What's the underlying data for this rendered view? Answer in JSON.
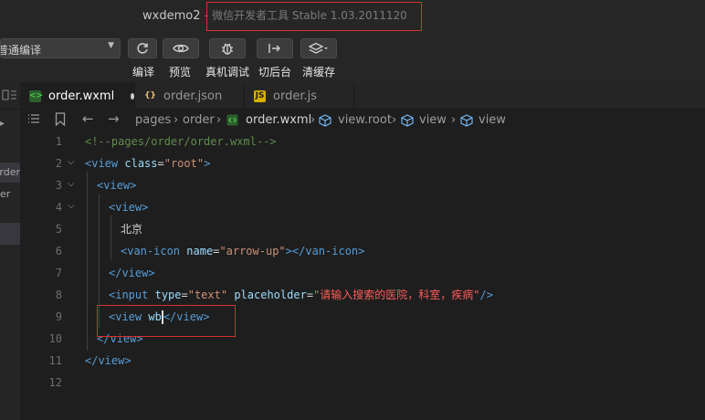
{
  "window": {
    "project": "wxdemo2",
    "separator": "-",
    "app_name": "微信开发者工具 Stable 1.03.2011120"
  },
  "toolbar": {
    "compile_mode": "普通编译",
    "buttons": [
      {
        "icon": "refresh-icon",
        "label": "编译"
      },
      {
        "icon": "eye-icon",
        "label": "预览"
      },
      {
        "icon": "bug-icon",
        "label": "真机调试"
      },
      {
        "icon": "switch-icon",
        "label": "切后台"
      },
      {
        "icon": "layers-icon",
        "label": "清缓存"
      }
    ]
  },
  "tabs": [
    {
      "label": "order.wxml",
      "icon": "<>",
      "color": "#4ec94e",
      "active": true,
      "modified": true
    },
    {
      "label": "order.json",
      "icon": "{}",
      "color": "#e5c07b",
      "active": false
    },
    {
      "label": "order.js",
      "icon": "JS",
      "color": "#f0d000",
      "active": false
    }
  ],
  "breadcrumb": {
    "items": [
      "pages",
      "order",
      "order.wxml",
      "view.root",
      "view",
      "view"
    ]
  },
  "sidebar": {
    "items": [
      "rder",
      "er"
    ]
  },
  "editor": {
    "line_numbers": [
      "1",
      "2",
      "3",
      "4",
      "5",
      "6",
      "7",
      "8",
      "9",
      "10",
      "11",
      "12"
    ],
    "comment": "<!--pages/order/order.wxml-->",
    "tag_view": "view",
    "tag_van_icon": "van-icon",
    "tag_input": "input",
    "attr_class": "class",
    "attr_name": "name",
    "attr_type": "type",
    "attr_placeholder": "placeholder",
    "val_root": "\"root\"",
    "val_arrow": "\"arrow-up\"",
    "val_text": "\"text\"",
    "val_placeholder": "\"请输入搜索的医院，科室，疾病\"",
    "text_beijing": "北京",
    "typing": "wb"
  },
  "colors": {
    "highlight_box": "#d93030",
    "comment": "#608b4e",
    "tag": "#569cd6",
    "attribute": "#9cdcfe",
    "string": "#ce9178"
  }
}
